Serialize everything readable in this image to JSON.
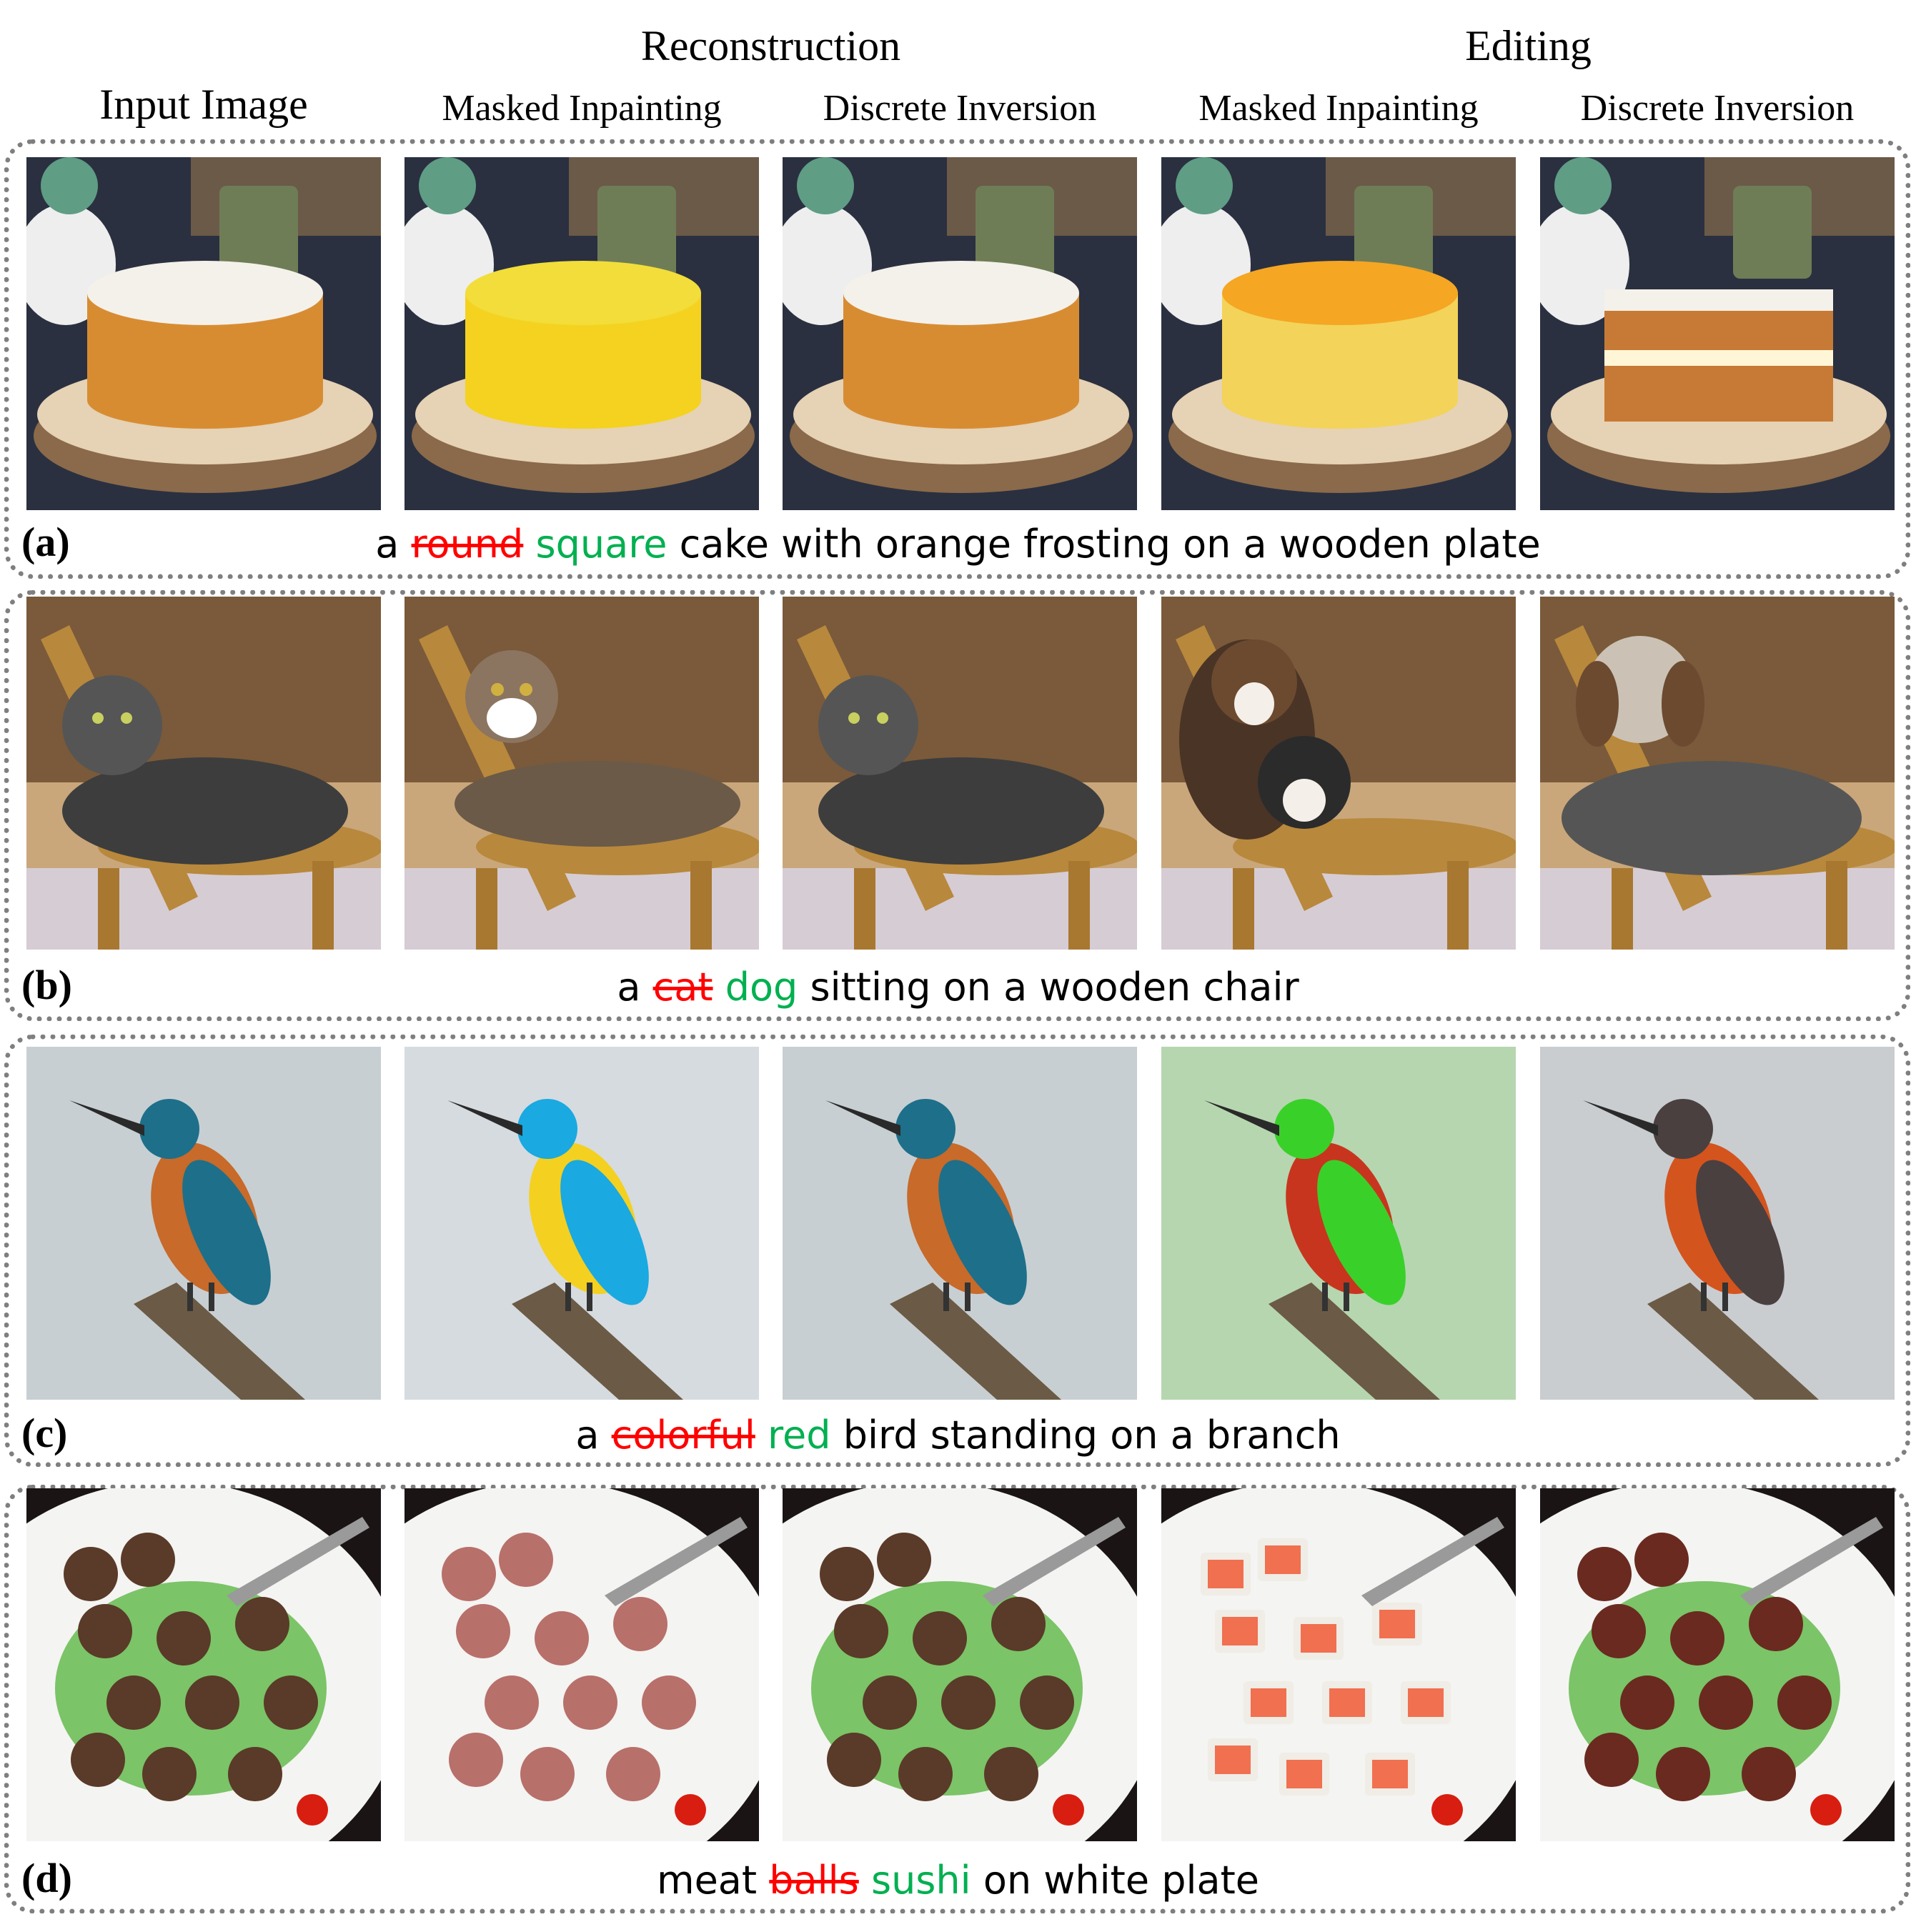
{
  "header": {
    "groups": [
      {
        "label": "Reconstruction"
      },
      {
        "label": "Editing"
      }
    ],
    "columns": [
      {
        "label": "Input Image"
      },
      {
        "label": "Masked Inpainting"
      },
      {
        "label": "Discrete Inversion"
      },
      {
        "label": "Masked Inpainting"
      },
      {
        "label": "Discrete Inversion"
      }
    ]
  },
  "colors": {
    "deleted_word": "#ff0000",
    "inserted_word": "#00b050",
    "panel_border": "#7f7f7f"
  },
  "rows": [
    {
      "label": "(a)",
      "caption": {
        "before": "a",
        "deleted": "round",
        "inserted": "square",
        "after": "cake with orange frosting on a wooden plate"
      },
      "images": [
        {
          "description": "round cake with white swirl frosting on wooden slice plate"
        },
        {
          "description": "yellow cake with piped yellow frosting on wooden plate"
        },
        {
          "description": "round cake with white swirl frosting, reconstructed"
        },
        {
          "description": "yellow sponge cake with orange frosting, slice cut"
        },
        {
          "description": "square layered cake with white frosting on wooden plate"
        }
      ]
    },
    {
      "label": "(b)",
      "caption": {
        "before": "a",
        "deleted": "cat",
        "inserted": "dog",
        "after": "sitting on a wooden chair"
      },
      "images": [
        {
          "description": "grey tabby cat lying on wooden chair"
        },
        {
          "description": "tabby and white cat lying on wooden chair"
        },
        {
          "description": "grey tabby cat on wooden chair, reconstructed"
        },
        {
          "description": "two dogs on wooden chair"
        },
        {
          "description": "fluffy dog on wooden chair"
        }
      ]
    },
    {
      "label": "(c)",
      "caption": {
        "before": "a",
        "deleted": "colorful",
        "inserted": "red",
        "after": "bird standing on a branch"
      },
      "images": [
        {
          "description": "kingfisher perched on branch"
        },
        {
          "description": "rainbow-colored bird perched on branch"
        },
        {
          "description": "kingfisher on branch, reconstructed"
        },
        {
          "description": "red bird with green wings on branch"
        },
        {
          "description": "orange and dark bird on branch"
        }
      ]
    },
    {
      "label": "(d)",
      "caption": {
        "before": "meat",
        "deleted": "balls",
        "inserted": "sushi",
        "after": "on white plate"
      },
      "images": [
        {
          "description": "meatballs with greens on white plate with fork"
        },
        {
          "description": "raw meatballs on white plate with fork"
        },
        {
          "description": "meatballs with greens, reconstructed"
        },
        {
          "description": "salmon sushi rolls on white plate with fork"
        },
        {
          "description": "sushi-like meat pieces with greens on white plate"
        }
      ]
    }
  ]
}
